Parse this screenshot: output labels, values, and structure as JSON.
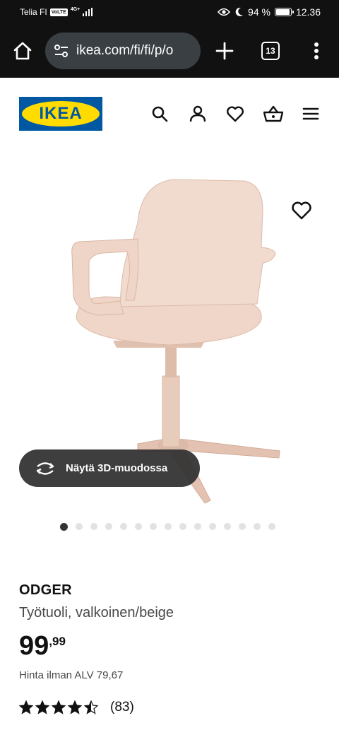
{
  "status_bar": {
    "carrier": "Telia FI",
    "volte": "VoLTE",
    "network": "4G+",
    "battery": "94 %",
    "battery_level": 0.94,
    "time": "12.36"
  },
  "browser": {
    "url": "ikea.com/fi/fi/p/o",
    "tab_count": "13"
  },
  "header": {
    "logo_text": "IKEA",
    "brand_blue": "#0058a3",
    "brand_yellow": "#ffdb00"
  },
  "gallery": {
    "view_3d_label": "Näytä 3D-muodossa",
    "total_images": 15,
    "active_index": 0
  },
  "product": {
    "name": "ODGER",
    "description": "Työtuoli, valkoinen/beige",
    "price_integer": "99",
    "price_decimal": ",99",
    "price_without_vat": "Hinta ilman ALV 79,67",
    "rating_value": 4.5,
    "rating_max": 5,
    "rating_count": "(83)"
  }
}
